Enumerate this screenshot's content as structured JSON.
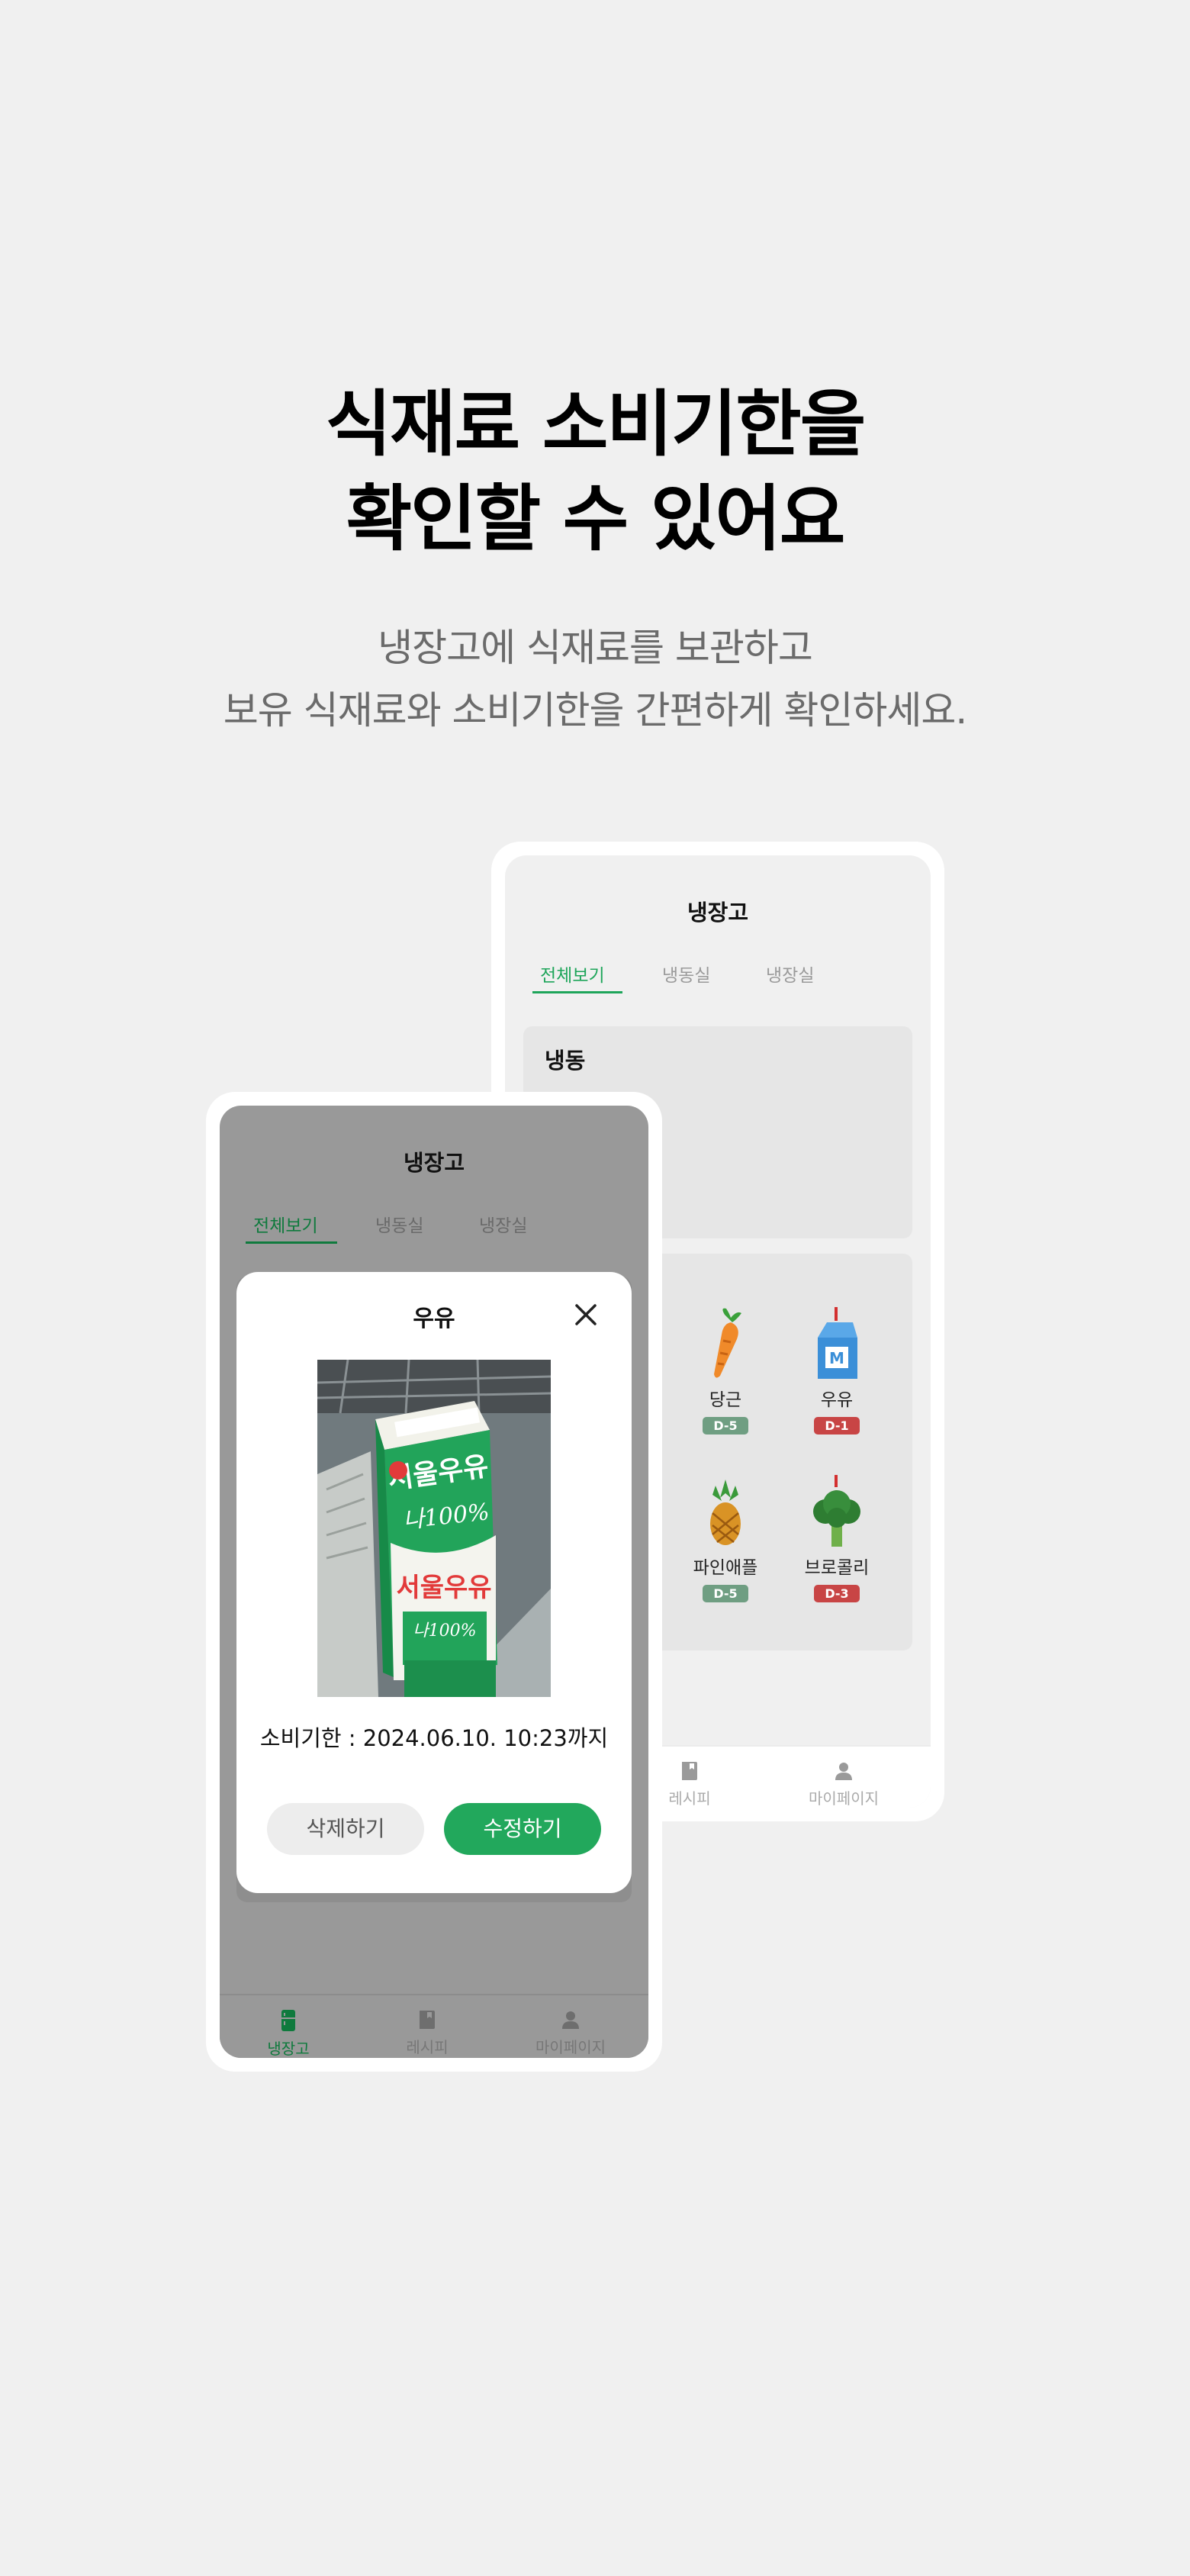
{
  "headline": {
    "line1": "식재료 소비기한을",
    "line2": "확인할 수 있어요"
  },
  "subline": {
    "line1": "냉장고에 식재료를 보관하고",
    "line2": "보유 식재료와 소비기한을 간편하게 확인하세요."
  },
  "back_screen": {
    "title": "냉장고",
    "tabs": [
      {
        "label": "전체보기",
        "active": true
      },
      {
        "label": "냉동실"
      },
      {
        "label": "냉장실"
      }
    ],
    "frozen_section": {
      "title": "냉동"
    },
    "items": [
      {
        "name": "당근",
        "badge": "D-5",
        "status": "ok",
        "icon": "carrot-icon"
      },
      {
        "name": "우유",
        "badge": "D-1",
        "status": "urgent",
        "icon": "milk-carton-icon"
      },
      {
        "name": "파인애플",
        "badge": "D-5",
        "status": "ok",
        "icon": "pineapple-icon"
      },
      {
        "name": "브로콜리",
        "badge": "D-3",
        "status": "urgent",
        "icon": "broccoli-icon"
      }
    ],
    "nav": [
      {
        "label": "레시피",
        "icon": "book-icon"
      },
      {
        "label": "마이페이지",
        "icon": "person-icon"
      }
    ]
  },
  "front_screen": {
    "title": "냉장고",
    "tabs": [
      {
        "label": "전체보기",
        "active": true
      },
      {
        "label": "냉동실"
      },
      {
        "label": "냉장실"
      }
    ],
    "modal": {
      "title": "우유",
      "expiry": "소비기한 : 2024.06.10. 10:23까지",
      "delete_label": "삭제하기",
      "edit_label": "수정하기",
      "photo_brand": "서울우유",
      "photo_sub": "나100%"
    },
    "nav": [
      {
        "label": "냉장고",
        "icon": "fridge-icon",
        "active": true
      },
      {
        "label": "레시피",
        "icon": "book-icon"
      },
      {
        "label": "마이페이지",
        "icon": "person-icon"
      }
    ]
  },
  "colors": {
    "accent": "#1ea55a",
    "urgent": "#c84545",
    "ok": "#6f9e82",
    "background": "#f0f0f0"
  }
}
